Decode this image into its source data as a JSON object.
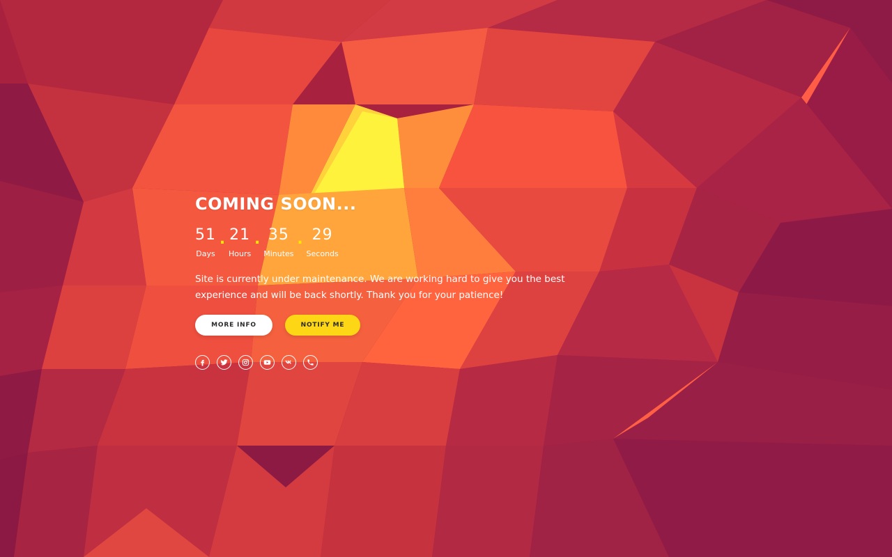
{
  "page": {
    "title": "COMING SOON...",
    "description": "Site is currently under maintenance. We are working hard to give you the best experience and will be back shortly. Thank you for your patience!"
  },
  "countdown": [
    {
      "value": "51",
      "label": "Days"
    },
    {
      "value": "21",
      "label": "Hours"
    },
    {
      "value": "35",
      "label": "Minutes"
    },
    {
      "value": "29",
      "label": "Seconds"
    }
  ],
  "countdown_separator": ".",
  "buttons": {
    "more_info": "MORE INFO",
    "notify_me": "NOTIFY ME"
  },
  "social": [
    {
      "icon": "facebook-icon"
    },
    {
      "icon": "twitter-icon"
    },
    {
      "icon": "instagram-icon"
    },
    {
      "icon": "youtube-icon"
    },
    {
      "icon": "vk-icon"
    },
    {
      "icon": "phone-icon"
    }
  ],
  "colors": {
    "background": "#a8213f",
    "accent": "#fdd715",
    "text": "#ffffff"
  }
}
